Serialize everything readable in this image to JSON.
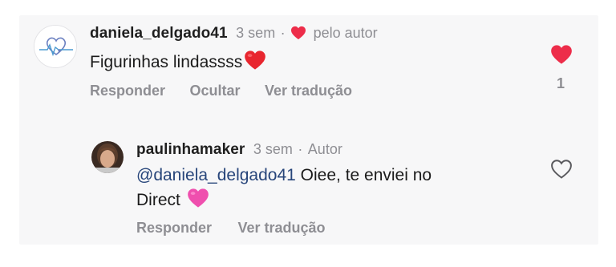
{
  "comments": [
    {
      "username": "daniela_delgado41",
      "time": "3 sem",
      "separator": "·",
      "liked_by_author_label": "pelo autor",
      "text": "Figurinhas lindassss",
      "emoji": "red-heart",
      "actions": [
        "Responder",
        "Ocultar",
        "Ver tradução"
      ],
      "like_count": "1",
      "liked": true
    }
  ],
  "reply": {
    "username": "paulinhamaker",
    "time": "3 sem",
    "separator": "·",
    "author_badge": "Autor",
    "mention": "@daniela_delgado41",
    "text_line1": " Oiee, te enviei no",
    "text_line2": "Direct",
    "emoji": "pink-heart",
    "actions": [
      "Responder",
      "Ver tradução"
    ],
    "liked": false
  },
  "colors": {
    "like_red": "#ed2d4a",
    "muted_text": "#8e8e93",
    "mention_blue": "#27457a",
    "pink_heart": "#ef4fae"
  }
}
